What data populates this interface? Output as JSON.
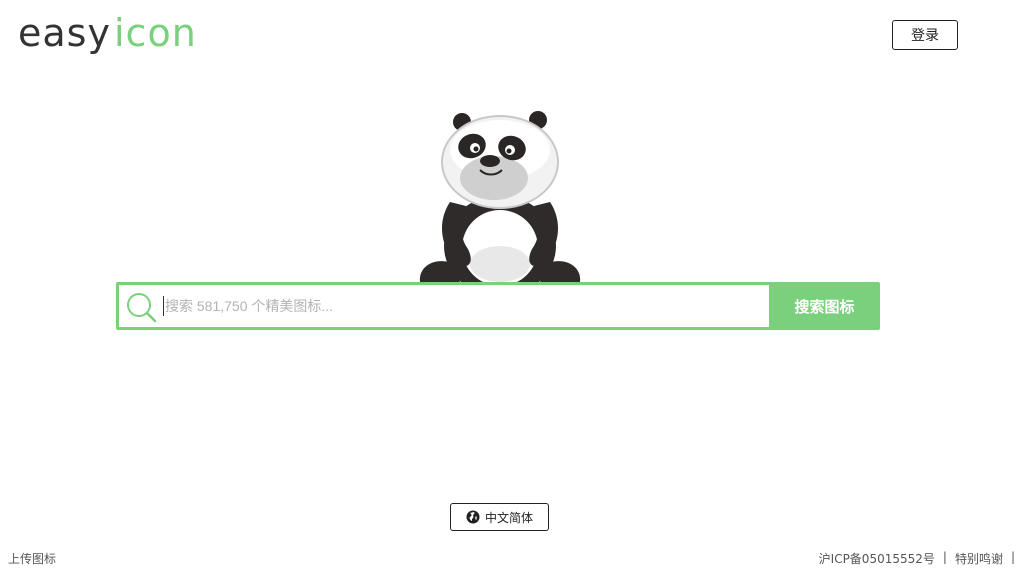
{
  "header": {
    "logo_text_easy": "easy",
    "logo_text_icon": "icon",
    "login_label": "登录"
  },
  "search": {
    "placeholder": "搜索 581,750 个精美图标...",
    "button_label": "搜索图标"
  },
  "language": {
    "label": "中文简体"
  },
  "footer": {
    "upload_label": "上传图标",
    "icp_label": "沪ICP备05015552号",
    "separator": "|",
    "thanks_label": "特别鸣谢"
  },
  "colors": {
    "accent": "#7bd07d",
    "logo_dark": "#333333",
    "logo_green": "#7bd07d"
  }
}
